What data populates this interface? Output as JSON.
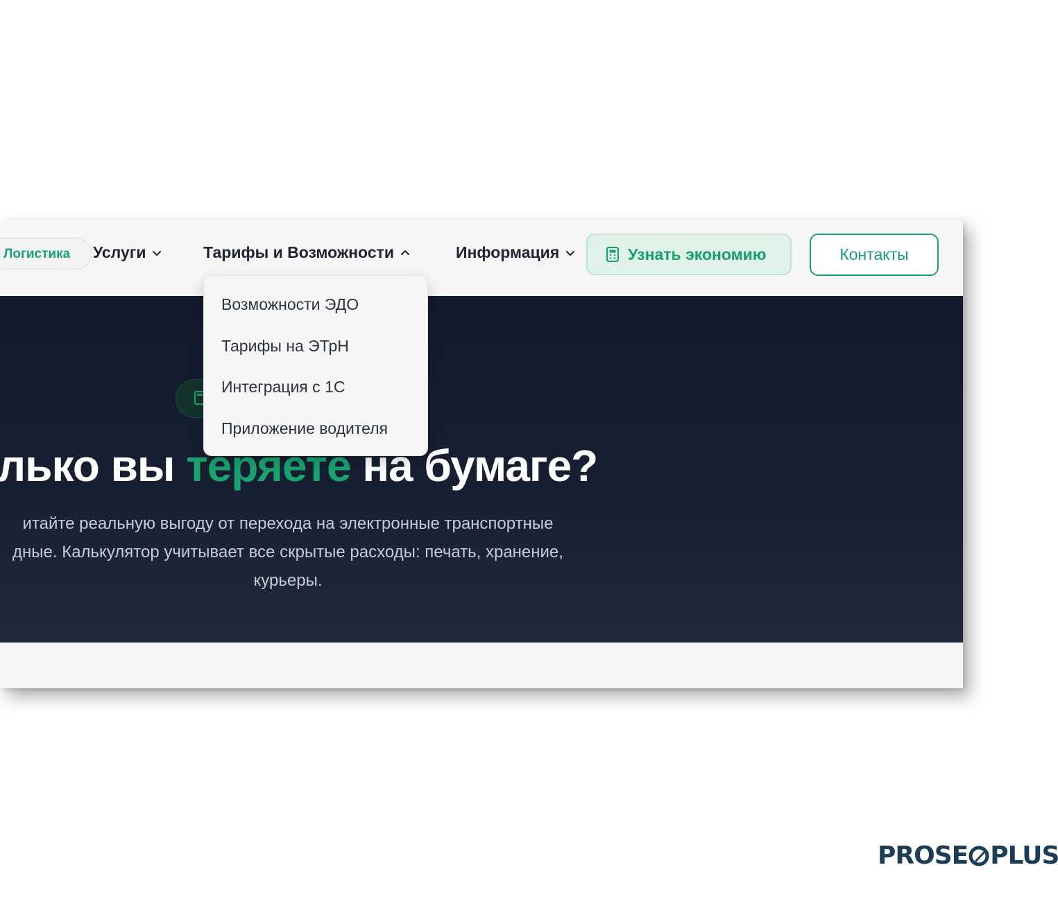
{
  "nav": {
    "brand_chip_label": "Логистика",
    "services_label": "Услуги",
    "tariffs_label": "Тарифы и Возможности",
    "info_label": "Информация",
    "cta_savings_label": "Узнать экономию",
    "contacts_label": "Контакты"
  },
  "dropdown": {
    "items": [
      "Возможности ЭДО",
      "Тарифы на ЭТрН",
      "Интеграция с 1С",
      "Приложение водителя"
    ]
  },
  "hero": {
    "title_part1": "олько вы ",
    "title_accent": "теряете",
    "title_part2": " на бумаге?",
    "subtitle_line1": "итайте реальную выгоду от перехода на электронные транспортные",
    "subtitle_line2": "дные. Калькулятор учитывает все скрытые расходы: печать, хранение,",
    "subtitle_line3": "курьеры."
  },
  "watermark": {
    "left": "PROSE",
    "right": "PLUS"
  },
  "colors": {
    "accent_green": "#1aa371",
    "hero_dark": "#121a2b",
    "brand_navy": "#1b3d55"
  }
}
